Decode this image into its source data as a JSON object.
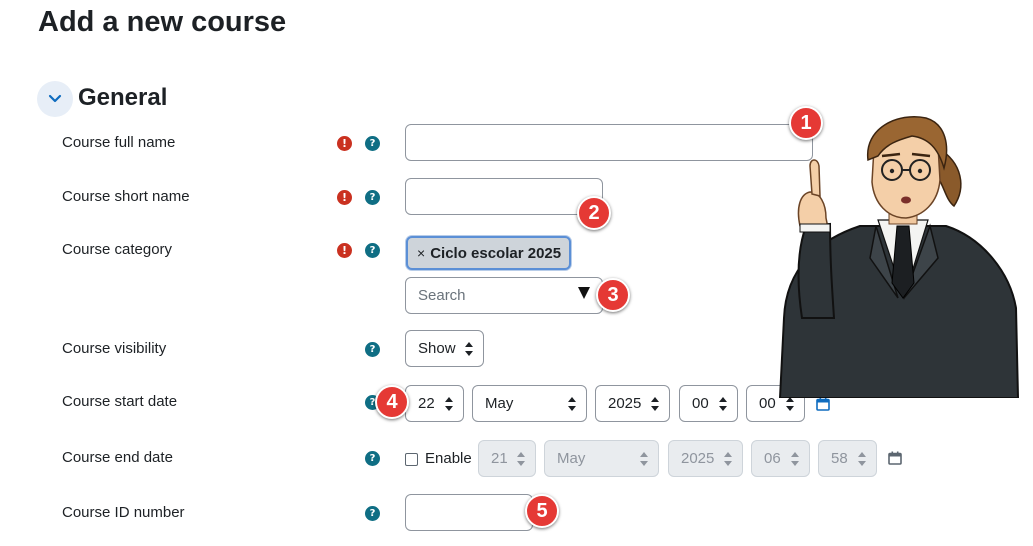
{
  "page": {
    "title": "Add a new course"
  },
  "section": {
    "title": "General",
    "toggle_icon": "chevron-down-icon"
  },
  "colors": {
    "required": "#ca3120",
    "help": "#0f6e84",
    "badge": "#e53935",
    "calendar": "#0f6cbf"
  },
  "fields": {
    "fullname": {
      "label": "Course full name",
      "value": "",
      "placeholder": ""
    },
    "shortname": {
      "label": "Course short name",
      "value": "",
      "placeholder": ""
    },
    "category": {
      "label": "Course category",
      "selected_tag": "Ciclo escolar 2025",
      "tag_remove": "×",
      "search_placeholder": "Search"
    },
    "visibility": {
      "label": "Course visibility",
      "value": "Show"
    },
    "startdate": {
      "label": "Course start date",
      "day": "22",
      "month": "May",
      "year": "2025",
      "hour": "00",
      "minute": "00"
    },
    "enddate": {
      "label": "Course end date",
      "enable_label": "Enable",
      "enabled": false,
      "day": "21",
      "month": "May",
      "year": "2025",
      "hour": "06",
      "minute": "58"
    },
    "idnumber": {
      "label": "Course ID number",
      "value": "",
      "placeholder": ""
    }
  },
  "icons": {
    "required": "!",
    "help": "?"
  },
  "badges": [
    "1",
    "2",
    "3",
    "4",
    "5"
  ]
}
